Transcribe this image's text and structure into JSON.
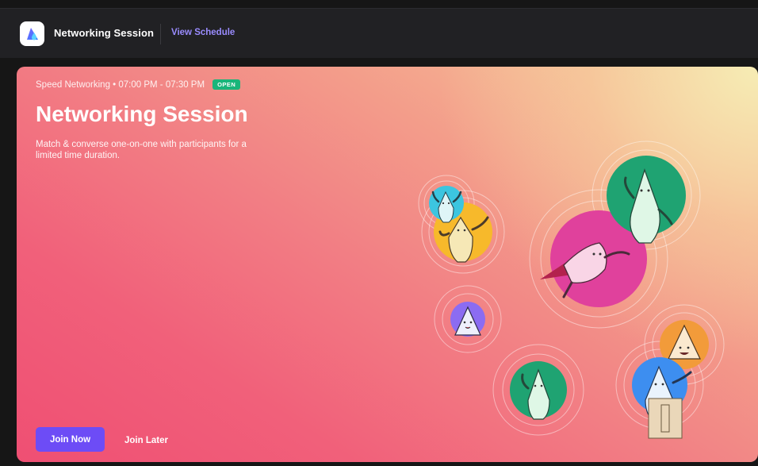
{
  "header": {
    "title": "Networking Session",
    "link": "View Schedule",
    "logo_icon": "droplet-logo-icon"
  },
  "hero": {
    "meta": "Speed Networking • 07:00 PM - 07:30 PM",
    "badge": "OPEN",
    "title": "Networking Session",
    "description": "Match & converse one-on-one with participants for a limited time duration.",
    "primary_action": "Join Now",
    "secondary_action": "Join Later"
  },
  "colors": {
    "accent": "#6d4cf6",
    "link": "#9a8cff",
    "status_open": "#19b57a",
    "topbar": "#212124"
  },
  "illustration": {
    "description_icon": "networking-characters-icon"
  }
}
